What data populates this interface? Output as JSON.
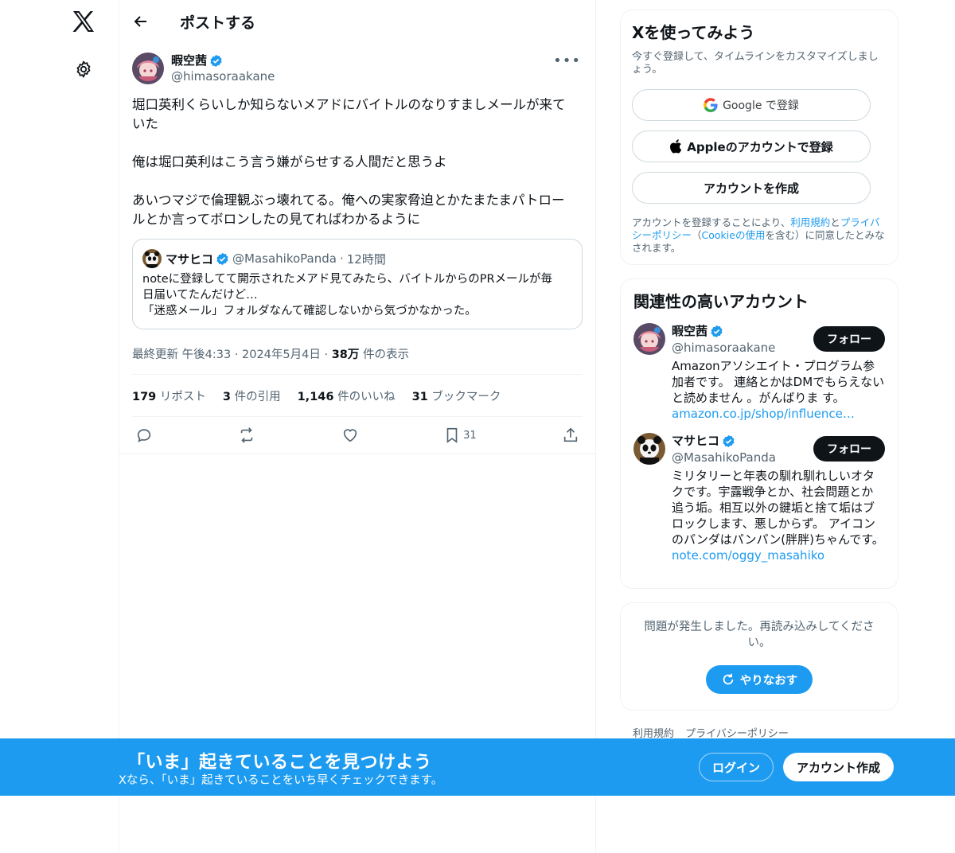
{
  "nav": {
    "logo_icon": "x-logo-icon",
    "settings_icon": "gear-icon"
  },
  "header": {
    "title": "ポストする"
  },
  "post": {
    "author_name": "暇空茜",
    "author_handle": "@himasoraakane",
    "text": "堀口英利くらいしか知らないメアドにバイトルのなりすましメールが来て\nいた\n\n俺は堀口英利はこう言う嫌がらせする人間だと思うよ\n\nあいつマジで倫理観ぶっ壊れてる。俺への実家脅迫とかたまたまパトロー\nルとか言ってボロンしたの見てればわかるように",
    "quote": {
      "name": "マサヒコ",
      "handle": "@MasahikoPanda",
      "time": "12時間",
      "text": "noteに登録してて開示されたメアド見てみたら、バイトルからのPRメールが毎\n日届いてたんだけど…\n「迷惑メール」フォルダなんて確認しないから気づかなかった。"
    },
    "meta_time": "最終更新 午後4:33 · 2024年5月4日 · ",
    "views_count": "38万",
    "views_label": " 件の表示",
    "stats": {
      "reposts_count": "179",
      "reposts_label": " リポスト",
      "quotes_count": "3",
      "quotes_label": " 件の引用",
      "likes_count": "1,146",
      "likes_label": " 件のいいね",
      "bookmarks_count": "31",
      "bookmarks_label": " ブックマーク"
    },
    "bookmark_action_count": "31"
  },
  "signup_card": {
    "title": "Xを使ってみよう",
    "subtitle": "今すぐ登録して、タイムラインをカスタマイズしましょう。",
    "google_label": "Google で登録",
    "apple_label": "Appleのアカウントで登録",
    "create_label": "アカウントを作成",
    "legal_prefix": "アカウントを登録することにより、",
    "legal_terms": "利用規約",
    "legal_and": "と",
    "legal_privacy": "プライバシーポリシー",
    "legal_mid": "（",
    "legal_cookie": "Cookieの使用",
    "legal_suffix": "を含む）に同意したとみなされます。"
  },
  "related_card": {
    "title": "関連性の高いアカウント",
    "follow_label": "フォロー",
    "accounts": [
      {
        "name": "暇空茜",
        "handle": "@himasoraakane",
        "bio": "Amazonアソシエイト・プログラム参加者です。 連絡とかはDMでもらえないと読めません 。がんばりま す。",
        "link": "amazon.co.jp/shop/influence…"
      },
      {
        "name": "マサヒコ",
        "handle": "@MasahikoPanda",
        "bio": "ミリタリーと年表の馴れ馴れしいオタクです。宇露戦争とか、社会問題とか追う垢。相互以外の鍵垢と捨て垢はブロックします、悪しからず。 アイコンのパンダはパンパン(胖胖)ちゃんです。",
        "link": "note.com/oggy_masahiko"
      }
    ]
  },
  "error_card": {
    "text": "問題が発生しました。再読み込みしてください。",
    "retry_label": "やりなおす"
  },
  "footer": {
    "terms": "利用規約",
    "privacy": "プライバシーポリシー"
  },
  "banner": {
    "title": "「いま」起きていることを見つけよう",
    "subtitle": "Xなら、「いま」起きていることをいち早くチェックできます。",
    "login_label": "ログイン",
    "create_label": "アカウント作成"
  },
  "colors": {
    "accent": "#1d9bf0",
    "text": "#0f1419",
    "muted": "#536471",
    "border": "#eff3f4"
  }
}
